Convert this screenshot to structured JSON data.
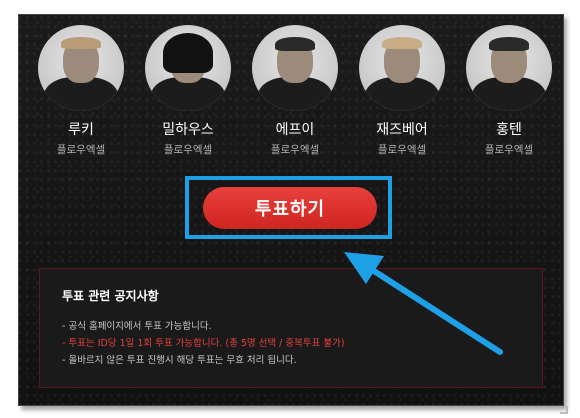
{
  "artists": [
    {
      "name": "루키",
      "team": "플로우엑셀"
    },
    {
      "name": "밀하우스",
      "team": "플로우엑셀"
    },
    {
      "name": "에프이",
      "team": "플로우엑셀"
    },
    {
      "name": "재즈베어",
      "team": "플로우엑셀"
    },
    {
      "name": "홍텐",
      "team": "플로우엑셀"
    }
  ],
  "vote": {
    "label": "투표하기"
  },
  "notice": {
    "title": "투표 관련 공지사항",
    "items": [
      "- 공식 홈페이지에서 투표 가능합니다.",
      "- 투표는 ID당 1일 1회 투표 가능합니다. (총 5명 선택 / 중복투표 불가)",
      "- 올바르지 않은 투표 진행시 해당 투표는 무효 처리 됩니다."
    ]
  },
  "colors": {
    "accent": "#1ea0e6",
    "vote_red": "#d9302c",
    "warning_red": "#e0423c"
  }
}
